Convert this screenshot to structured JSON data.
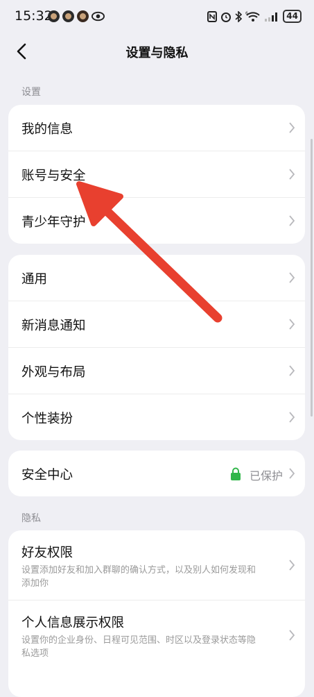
{
  "status_bar": {
    "time": "15:32",
    "battery": "44",
    "wifi_label": "6"
  },
  "nav": {
    "title": "设置与隐私"
  },
  "sections": [
    {
      "label": "设置"
    },
    {
      "label": "隐私"
    }
  ],
  "group1": {
    "items": [
      {
        "label": "我的信息"
      },
      {
        "label": "账号与安全"
      },
      {
        "label": "青少年守护"
      }
    ]
  },
  "group2": {
    "items": [
      {
        "label": "通用"
      },
      {
        "label": "新消息通知"
      },
      {
        "label": "外观与布局"
      },
      {
        "label": "个性装扮"
      }
    ]
  },
  "group3": {
    "items": [
      {
        "label": "安全中心",
        "status": "已保护"
      }
    ]
  },
  "privacy": {
    "items": [
      {
        "label": "好友权限",
        "description": "设置添加好友和加入群聊的确认方式，以及别人如何发现和添加你"
      },
      {
        "label": "个人信息展示权限",
        "description": "设置你的企业身份、日程可见范围、时区以及登录状态等隐私选项"
      }
    ]
  },
  "colors": {
    "background": "#efeff4",
    "card": "#ffffff",
    "annotation_arrow": "#e8402f",
    "lock": "#31b64a"
  }
}
